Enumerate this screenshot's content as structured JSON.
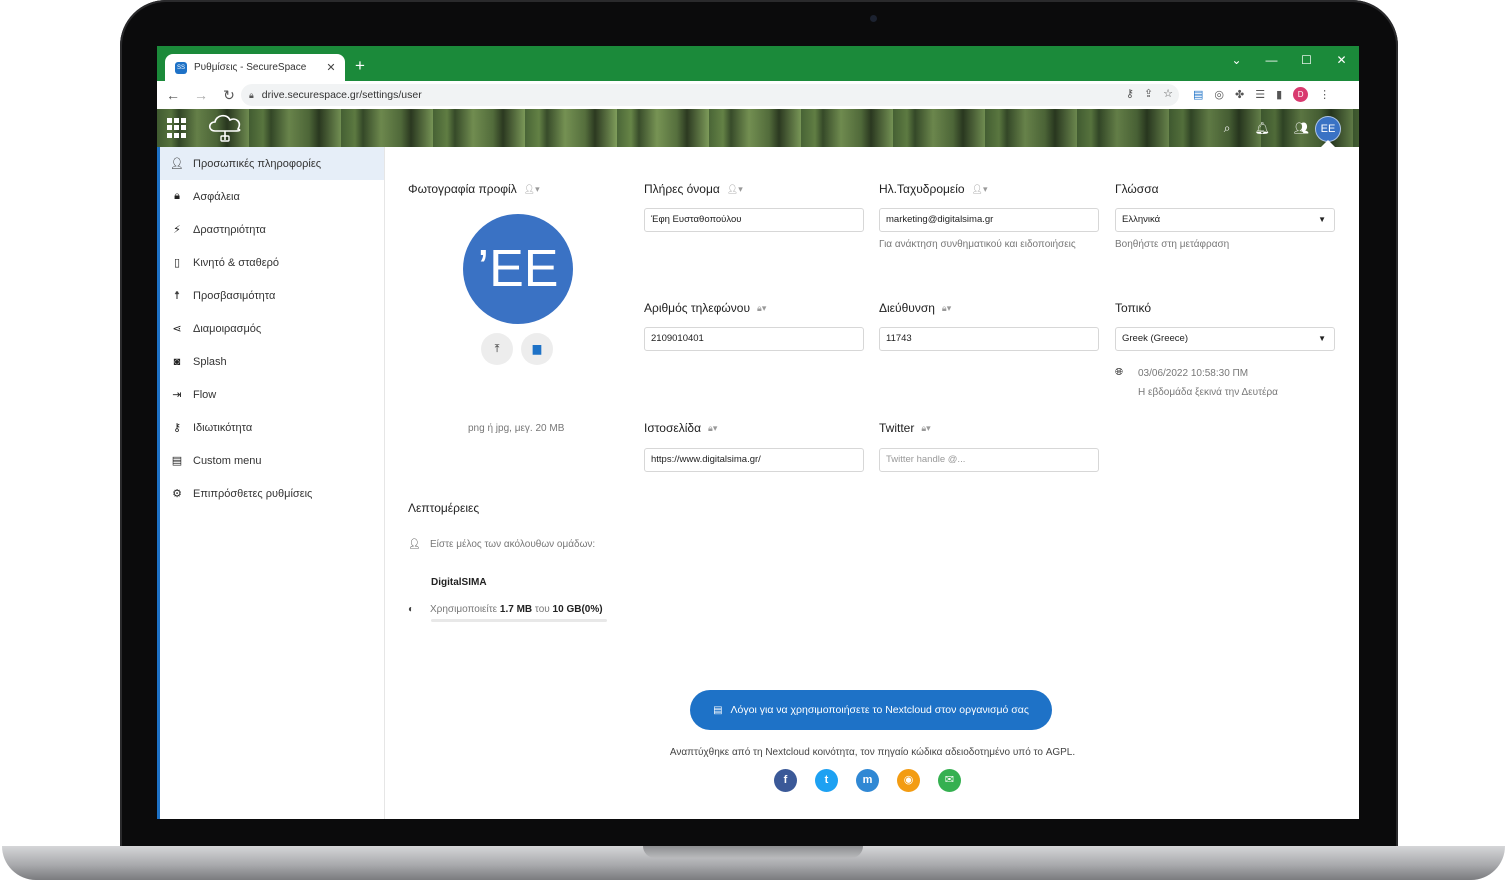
{
  "browser": {
    "tab_title": "Ρυθμίσεις - SecureSpace",
    "favicon_text": "SS",
    "tab_close": "✕",
    "new_tab": "+",
    "url": "drive.securespace.gr/settings/user",
    "profile_initial": "D",
    "win_min": "—",
    "win_max": "☐",
    "win_close": "✕",
    "win_menu": "⌄"
  },
  "header": {
    "avatar_initials": "EE"
  },
  "sidebar": {
    "items": [
      {
        "label": "Προσωπικές πληροφορίες",
        "icon": "user-icon"
      },
      {
        "label": "Ασφάλεια",
        "icon": "lock-icon"
      },
      {
        "label": "Δραστηριότητα",
        "icon": "lightning-icon"
      },
      {
        "label": "Κινητό & σταθερό",
        "icon": "phone-icon"
      },
      {
        "label": "Προσβασιμότητα",
        "icon": "accessibility-icon"
      },
      {
        "label": "Διαμοιρασμός",
        "icon": "share-icon"
      },
      {
        "label": "Splash",
        "icon": "camera-icon"
      },
      {
        "label": "Flow",
        "icon": "flow-icon"
      },
      {
        "label": "Ιδιωτικότητα",
        "icon": "key-icon"
      },
      {
        "label": "Custom menu",
        "icon": "menu-icon"
      },
      {
        "label": "Επιπρόσθετες ρυθμίσεις",
        "icon": "gear-icon"
      }
    ]
  },
  "profile": {
    "photo_title": "Φωτογραφία προφίλ",
    "avatar_initials": "’EE",
    "photo_hint": "png ή jpg, μεγ. 20 MB"
  },
  "fields": {
    "fullname": {
      "label": "Πλήρες όνομα",
      "value": "Έφη Ευσταθοπούλου"
    },
    "email": {
      "label": "Ηλ.Ταχυδρομείο",
      "value": "marketing@digitalsima.gr",
      "hint": "Για ανάκτηση συνθηματικού και ειδοποιήσεις"
    },
    "language": {
      "label": "Γλώσσα",
      "value": "Ελληνικά",
      "hint": "Βοηθήστε στη μετάφραση"
    },
    "phone": {
      "label": "Αριθμός τηλεφώνου",
      "value": "2109010401"
    },
    "address": {
      "label": "Διεύθυνση",
      "value": "11743"
    },
    "locale": {
      "label": "Τοπικό",
      "value": "Greek (Greece)",
      "datetime": "03/06/2022 10:58:30 ΠΜ",
      "week_hint": "Η εβδομάδα ξεκινά την Δευτέρα"
    },
    "website": {
      "label": "Ιστοσελίδα",
      "value": "https://www.digitalsima.gr/"
    },
    "twitter": {
      "label": "Twitter",
      "placeholder": "Twitter handle @..."
    }
  },
  "details": {
    "title": "Λεπτομέρειες",
    "groups_text": "Είστε μέλος των ακόλουθων ομάδων:",
    "group_name": "DigitalSIMA",
    "quota_prefix": "Χρησιμοποιείτε",
    "quota_used": "1.7 MB",
    "quota_mid": "του",
    "quota_total": "10 GB",
    "quota_pct": "(0%)",
    "quota_fraction": 0.0
  },
  "footer": {
    "cta": "Λόγοι για να χρησιμοποιήσετε το Nextcloud στον οργανισμό σας",
    "credit": "Αναπτύχθηκε από τη Nextcloud κοινότητα, τον πηγαίο κώδικα αδειοδοτημένο υπό το AGPL.",
    "socials": [
      {
        "name": "facebook-icon",
        "glyph": "f",
        "color": "#3b5998"
      },
      {
        "name": "twitter-icon",
        "glyph": "t",
        "color": "#1da1f2"
      },
      {
        "name": "mastodon-icon",
        "glyph": "m",
        "color": "#3088d4"
      },
      {
        "name": "rss-icon",
        "glyph": "◉",
        "color": "#f39c12"
      },
      {
        "name": "mail-icon",
        "glyph": "✉",
        "color": "#35b050"
      }
    ]
  }
}
